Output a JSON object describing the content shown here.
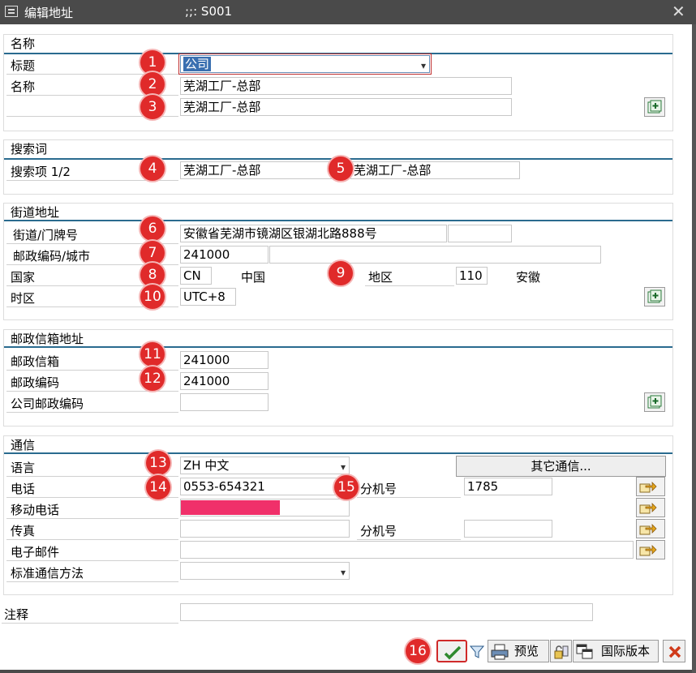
{
  "window": {
    "title": "编辑地址",
    "subtitle": ";;:  S001"
  },
  "sections": {
    "name": {
      "title": "名称",
      "label_title": "标题",
      "label_name": "名称",
      "title_value": "公司",
      "name1": "芜湖工厂-总部",
      "name2": "芜湖工厂-总部"
    },
    "search": {
      "title": "搜索词",
      "label": "搜索项 1/2",
      "term1": "芜湖工厂-总部",
      "term2": "芜湖工厂-总部"
    },
    "street": {
      "title": "街道地址",
      "label_street": "街道/门牌号",
      "street_value": "安徽省芜湖市镜湖区银湖北路888号",
      "street_extra": "",
      "label_postal": "邮政编码/城市",
      "postal_value": "241000",
      "city_value": "",
      "label_country": "国家",
      "country_code": "CN",
      "country_name": "中国",
      "label_region": "地区",
      "region_code": "110",
      "region_name": "安徽",
      "label_timezone": "时区",
      "timezone_value": "UTC+8"
    },
    "pobox": {
      "title": "邮政信箱地址",
      "label_box": "邮政信箱",
      "box_value": "241000",
      "label_postal": "邮政编码",
      "postal_value": "241000",
      "label_company_postal": "公司邮政编码",
      "company_postal_value": ""
    },
    "comm": {
      "title": "通信",
      "label_language": "语言",
      "language_value": "ZH 中文",
      "other_button": "其它通信...",
      "label_phone": "电话",
      "phone_value": "0553-654321",
      "label_ext": "分机号",
      "ext_value": "1785",
      "label_mobile": "移动电话",
      "label_fax": "传真",
      "label_fax_ext": "分机号",
      "label_email": "电子邮件",
      "label_std_method": "标准通信方法"
    }
  },
  "notes": {
    "label": "注释"
  },
  "toolbar": {
    "preview": "预览",
    "intl_version": "国际版本"
  },
  "badges": [
    "1",
    "2",
    "3",
    "4",
    "5",
    "6",
    "7",
    "8",
    "9",
    "10",
    "11",
    "12",
    "13",
    "14",
    "15",
    "16"
  ],
  "colors": {
    "accent_line": "#2a6b8f",
    "badge": "#e02a2a",
    "redacted": "#f0306a"
  }
}
